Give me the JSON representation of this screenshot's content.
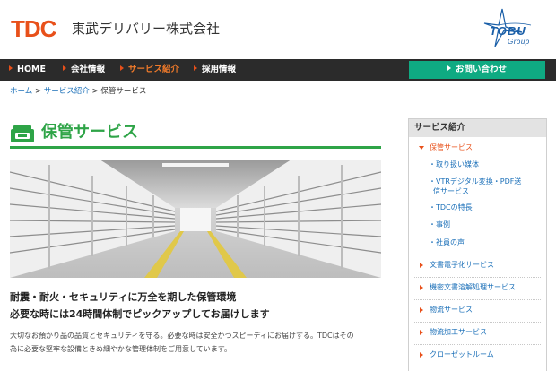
{
  "header": {
    "logo": "TDC",
    "company_name": "東武デリバリー株式会社",
    "group_logo": "TOBU",
    "group_sub": "Group"
  },
  "nav": {
    "items": [
      {
        "label": "HOME"
      },
      {
        "label": "会社情報"
      },
      {
        "label": "サービス紹介"
      },
      {
        "label": "採用情報"
      }
    ],
    "contact": "お問い合わせ"
  },
  "breadcrumb": {
    "home": "ホーム",
    "separator": ">",
    "services": "サービス紹介",
    "current": "保管サービス"
  },
  "page": {
    "title": "保管サービス",
    "lead1": "耐震・耐火・セキュリティに万全を期した保管環境",
    "lead2": "必要な時には24時間体制でピックアップしてお届けします",
    "desc1": "大切なお預かり品の品質とセキュリティを守る。必要な時は安全かつスピーディにお届けする。TDCはその",
    "desc2": "為に必要な堅牢な設備ときめ細やかな管理体制をご用意しています。"
  },
  "sidebar": {
    "heading": "サービス紹介",
    "active": "保管サービス",
    "subitems": [
      "・取り扱い媒体",
      "・VTRデジタル変換・PDF送",
      "信サービス",
      "・TDCの特長",
      "・事例",
      "・社員の声"
    ],
    "items": [
      "文書電子化サービス",
      "機密文書溶解処理サービス",
      "物流サービス",
      "物流加工サービス",
      "クローゼットルーム"
    ]
  },
  "colors": {
    "brand_orange": "#e8501a",
    "accent_green": "#2ea447",
    "contact_green": "#0faa82",
    "link_blue": "#1a6fb8",
    "nav_dark": "#2b2b2b"
  }
}
